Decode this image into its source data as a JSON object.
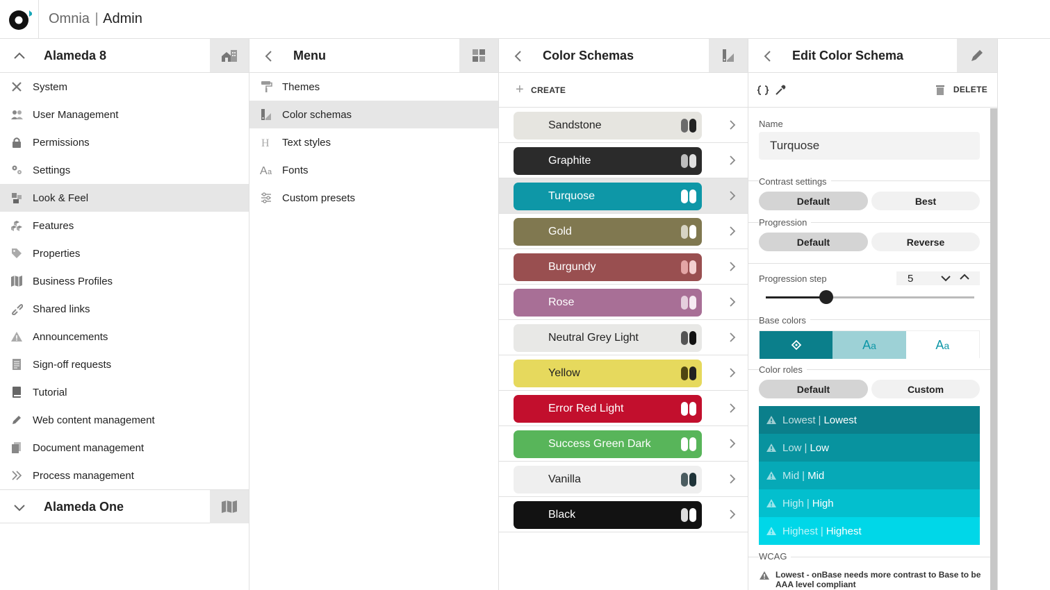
{
  "app": {
    "brand": "Omnia",
    "separator": "|",
    "section": "Admin"
  },
  "tenant": {
    "title": "Alameda 8",
    "collapsed_title": "Alameda One"
  },
  "nav": [
    {
      "label": "System",
      "icon": "tools-icon"
    },
    {
      "label": "User Management",
      "icon": "users-icon"
    },
    {
      "label": "Permissions",
      "icon": "lock-icon"
    },
    {
      "label": "Settings",
      "icon": "gears-icon"
    },
    {
      "label": "Look & Feel",
      "icon": "palette-icon",
      "active": true
    },
    {
      "label": "Features",
      "icon": "cubes-icon"
    },
    {
      "label": "Properties",
      "icon": "tag-icon"
    },
    {
      "label": "Business Profiles",
      "icon": "map-icon"
    },
    {
      "label": "Shared links",
      "icon": "link-icon"
    },
    {
      "label": "Announcements",
      "icon": "warning-icon"
    },
    {
      "label": "Sign-off requests",
      "icon": "document-icon"
    },
    {
      "label": "Tutorial",
      "icon": "book-icon"
    },
    {
      "label": "Web content management",
      "icon": "pen-icon"
    },
    {
      "label": "Document management",
      "icon": "files-icon"
    },
    {
      "label": "Process management",
      "icon": "double-chevron-icon"
    }
  ],
  "menu": {
    "title": "Menu",
    "items": [
      {
        "label": "Themes",
        "icon": "paint-roller-icon"
      },
      {
        "label": "Color schemas",
        "icon": "swatch-icon",
        "active": true
      },
      {
        "label": "Text styles",
        "icon": "heading-icon"
      },
      {
        "label": "Fonts",
        "icon": "font-icon"
      },
      {
        "label": "Custom presets",
        "icon": "sliders-icon"
      }
    ]
  },
  "schemas": {
    "title": "Color Schemas",
    "create_label": "CREATE",
    "items": [
      {
        "name": "Sandstone",
        "bg": "#e6e5e0",
        "fg": "#222222",
        "sw": [
          "#6b6b6b",
          "#222222"
        ]
      },
      {
        "name": "Graphite",
        "bg": "#2b2b2b",
        "fg": "#ffffff",
        "sw": [
          "#bdbdbd",
          "#e0e0e0"
        ]
      },
      {
        "name": "Turquose",
        "bg": "#0e97a7",
        "fg": "#ffffff",
        "sw": [
          "#ffffff",
          "#ffffff"
        ],
        "active": true
      },
      {
        "name": "Gold",
        "bg": "#807850",
        "fg": "#ffffff",
        "sw": [
          "#d7d4c4",
          "#ffffff"
        ]
      },
      {
        "name": "Burgundy",
        "bg": "#994f50",
        "fg": "#ffffff",
        "sw": [
          "#e3a5a5",
          "#f4d0d0"
        ]
      },
      {
        "name": "Rose",
        "bg": "#a86f96",
        "fg": "#ffffff",
        "sw": [
          "#e5cfdd",
          "#f6ebf2"
        ]
      },
      {
        "name": "Neutral Grey Light",
        "bg": "#e8e8e6",
        "fg": "#222222",
        "sw": [
          "#555555",
          "#111111"
        ]
      },
      {
        "name": "Yellow",
        "bg": "#e6d95d",
        "fg": "#222222",
        "sw": [
          "#4e4612",
          "#222222"
        ]
      },
      {
        "name": "Error Red Light",
        "bg": "#c20f2d",
        "fg": "#ffffff",
        "sw": [
          "#ffffff",
          "#ffffff"
        ]
      },
      {
        "name": "Success Green Dark",
        "bg": "#58b55a",
        "fg": "#ffffff",
        "sw": [
          "#ffffff",
          "#ffffff"
        ]
      },
      {
        "name": "Vanilla",
        "bg": "#efefef",
        "fg": "#222222",
        "sw": [
          "#4b5c60",
          "#1e3338"
        ]
      },
      {
        "name": "Black",
        "bg": "#121212",
        "fg": "#ffffff",
        "sw": [
          "#dddddd",
          "#ffffff"
        ]
      }
    ]
  },
  "edit": {
    "title": "Edit Color Schema",
    "delete_label": "DELETE",
    "name_label": "Name",
    "name_value": "Turquose",
    "contrast_label": "Contrast settings",
    "contrast_options": [
      "Default",
      "Best"
    ],
    "progression_label": "Progression",
    "progression_options": [
      "Default",
      "Reverse"
    ],
    "step_label": "Progression step",
    "step_value": "5",
    "step_slider_fraction": 0.29,
    "base_colors_label": "Base colors",
    "color_roles_label": "Color roles",
    "color_roles_options": [
      "Default",
      "Custom"
    ],
    "roles": [
      {
        "a": "Lowest",
        "b": "Lowest",
        "bg": "#0b7f8b"
      },
      {
        "a": "Low",
        "b": "Low",
        "bg": "#08939f"
      },
      {
        "a": "Mid",
        "b": "Mid",
        "bg": "#06a9b7"
      },
      {
        "a": "High",
        "b": "High",
        "bg": "#03bfce"
      },
      {
        "a": "Highest",
        "b": "Highest",
        "bg": "#00d7e8"
      }
    ],
    "wcag_label": "WCAG",
    "wcag_message": "Lowest - onBase needs more contrast to Base to be AAA level compliant"
  },
  "colors": {
    "accent": "#0e97a7"
  }
}
